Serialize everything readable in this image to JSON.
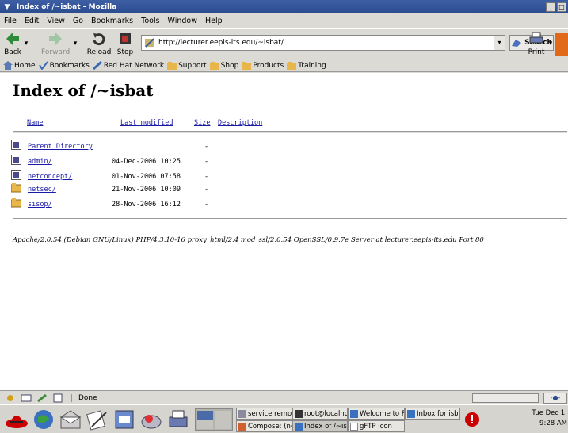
{
  "window": {
    "title": "Index of /~isbat - Mozilla",
    "menu_glyph": "▼",
    "min_glyph": "_",
    "max_glyph": "□"
  },
  "menubar": [
    "File",
    "Edit",
    "View",
    "Go",
    "Bookmarks",
    "Tools",
    "Window",
    "Help"
  ],
  "toolbar": {
    "back": "Back",
    "forward": "Forward",
    "reload": "Reload",
    "stop": "Stop",
    "url": "http://lecturer.eepis-its.edu/~isbat/",
    "search": "Search",
    "print": "Print",
    "dropdown_glyph": "▾"
  },
  "personal_toolbar": [
    "Home",
    "Bookmarks",
    "Red Hat Network",
    "Support",
    "Shop",
    "Products",
    "Training"
  ],
  "page": {
    "heading": "Index of /~isbat",
    "columns": {
      "name": "Name",
      "modified": "Last modified",
      "size": "Size",
      "description": "Description"
    },
    "rows": [
      {
        "name": "Parent Directory",
        "date": "",
        "size": "-",
        "icon": "back-icon"
      },
      {
        "name": "admin/",
        "date": "04-Dec-2006 10:25",
        "size": "-",
        "icon": "back-icon"
      },
      {
        "name": "netconcept/",
        "date": "01-Nov-2006 07:58",
        "size": "-",
        "icon": "back-icon"
      },
      {
        "name": "netsec/",
        "date": "21-Nov-2006 10:09",
        "size": "-",
        "icon": "folder-icon"
      },
      {
        "name": "sisop/",
        "date": "28-Nov-2006 16:12",
        "size": "-",
        "icon": "folder-icon"
      }
    ],
    "address": "Apache/2.0.54 (Debian GNU/Linux) PHP/4.3.10-16 proxy_html/2.4 mod_ssl/2.0.54 OpenSSL/0.9.7e Server at lecturer.eepis-its.edu Port 80"
  },
  "status": {
    "text": "Done"
  },
  "taskbar": {
    "tasks_top": [
      "service remot",
      "root@localho:",
      "Welcome to F",
      "Inbox for isba"
    ],
    "tasks_bottom": [
      "Compose: (nc",
      "Index of /~isl",
      "gFTP Icon"
    ],
    "clock_line1": "Tue Dec 1:",
    "clock_line2": "9:28 AM"
  },
  "colors": {
    "link": "#1a1aa8",
    "titlebar": "#2b4b8f"
  }
}
